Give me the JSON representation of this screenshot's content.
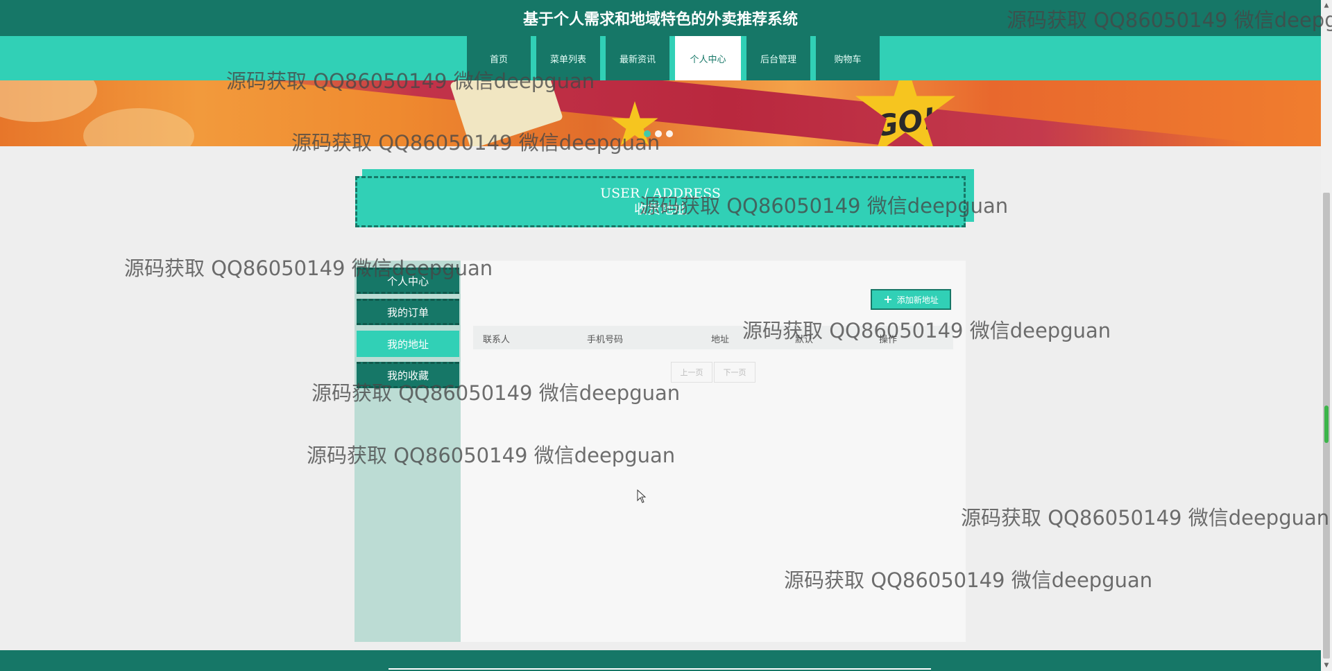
{
  "header": {
    "title": "基于个人需求和地域特色的外卖推荐系统"
  },
  "nav": {
    "tabs": [
      {
        "label": "首页",
        "active": false
      },
      {
        "label": "菜单列表",
        "active": false
      },
      {
        "label": "最新资讯",
        "active": false
      },
      {
        "label": "个人中心",
        "active": true
      },
      {
        "label": "后台管理",
        "active": false
      },
      {
        "label": "购物车",
        "active": false
      }
    ]
  },
  "banner": {
    "star_text": "GO!",
    "slide_count": 3,
    "active_slide": 1
  },
  "section": {
    "title_en": "USER / ADDRESS",
    "title_cn": "收货地址"
  },
  "sidebar": {
    "items": [
      {
        "label": "个人中心",
        "active": false
      },
      {
        "label": "我的订单",
        "active": false
      },
      {
        "label": "我的地址",
        "active": true
      },
      {
        "label": "我的收藏",
        "active": false
      }
    ]
  },
  "address": {
    "add_button_label": "添加新地址",
    "columns": [
      "联系人",
      "手机号码",
      "地址",
      "默认",
      "操作"
    ],
    "rows": []
  },
  "pagination": {
    "prev_label": "上一页",
    "next_label": "下一页"
  },
  "watermark": {
    "text": "源码获取 QQ86050149 微信deepguan"
  },
  "colors": {
    "primary_dark": "#167767",
    "primary_light": "#31d0b6"
  }
}
